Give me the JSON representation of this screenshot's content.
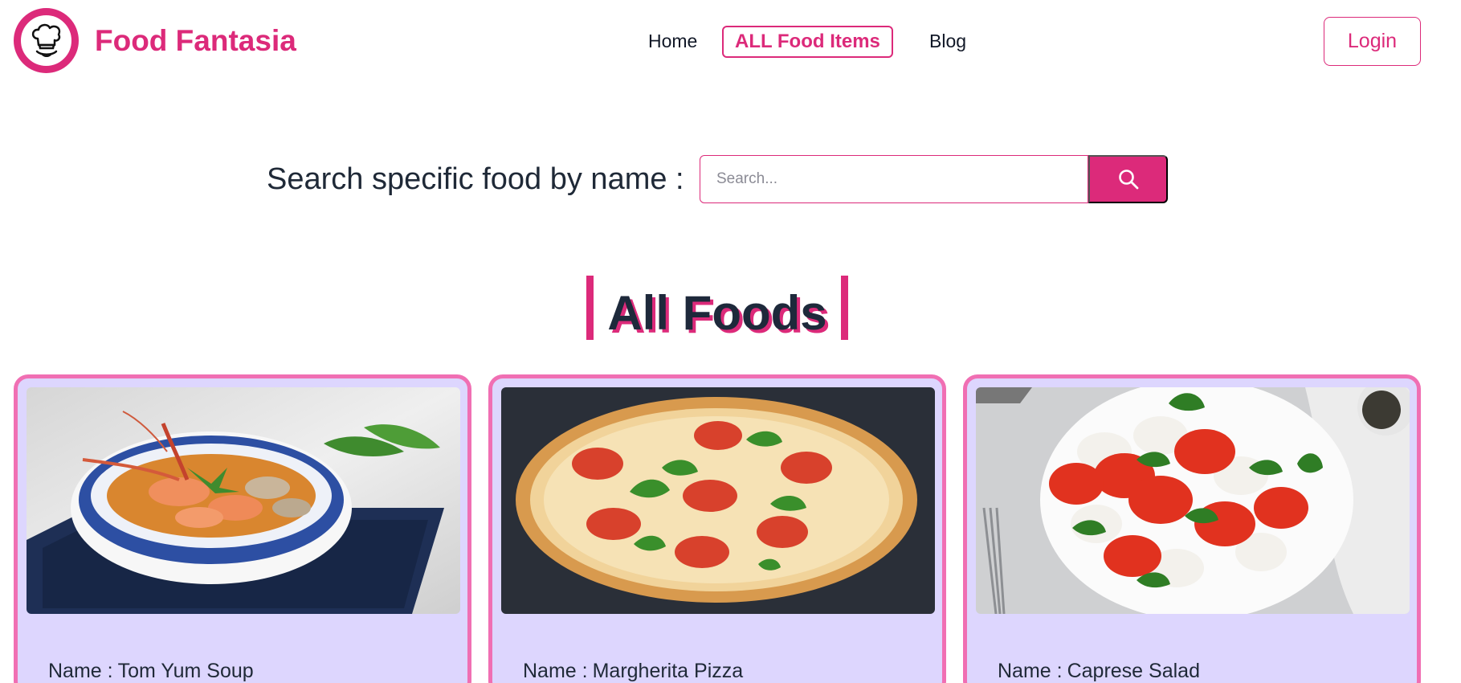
{
  "brand": {
    "name": "Food Fantasia",
    "logo_icon": "chef-hat-icon"
  },
  "nav": {
    "links": [
      {
        "label": "Home",
        "active": false
      },
      {
        "label": "ALL Food Items",
        "active": true
      },
      {
        "label": "Blog",
        "active": false
      }
    ],
    "login_label": "Login"
  },
  "search": {
    "label": "Search specific food by name :",
    "placeholder": "Search...",
    "value": "",
    "button_icon": "search-icon"
  },
  "section": {
    "title": "All Foods"
  },
  "foods": [
    {
      "name_label": "Name :",
      "name": "Tom Yum Soup",
      "image": "tom-yum-soup-photo"
    },
    {
      "name_label": "Name :",
      "name": "Margherita Pizza",
      "image": "margherita-pizza-photo"
    },
    {
      "name_label": "Name :",
      "name": "Caprese Salad",
      "image": "caprese-salad-photo"
    }
  ],
  "colors": {
    "accent": "#dc2a7a",
    "card_border": "#f06fb3",
    "card_bg": "#ddd6fe",
    "heading_text": "#1e293b"
  }
}
